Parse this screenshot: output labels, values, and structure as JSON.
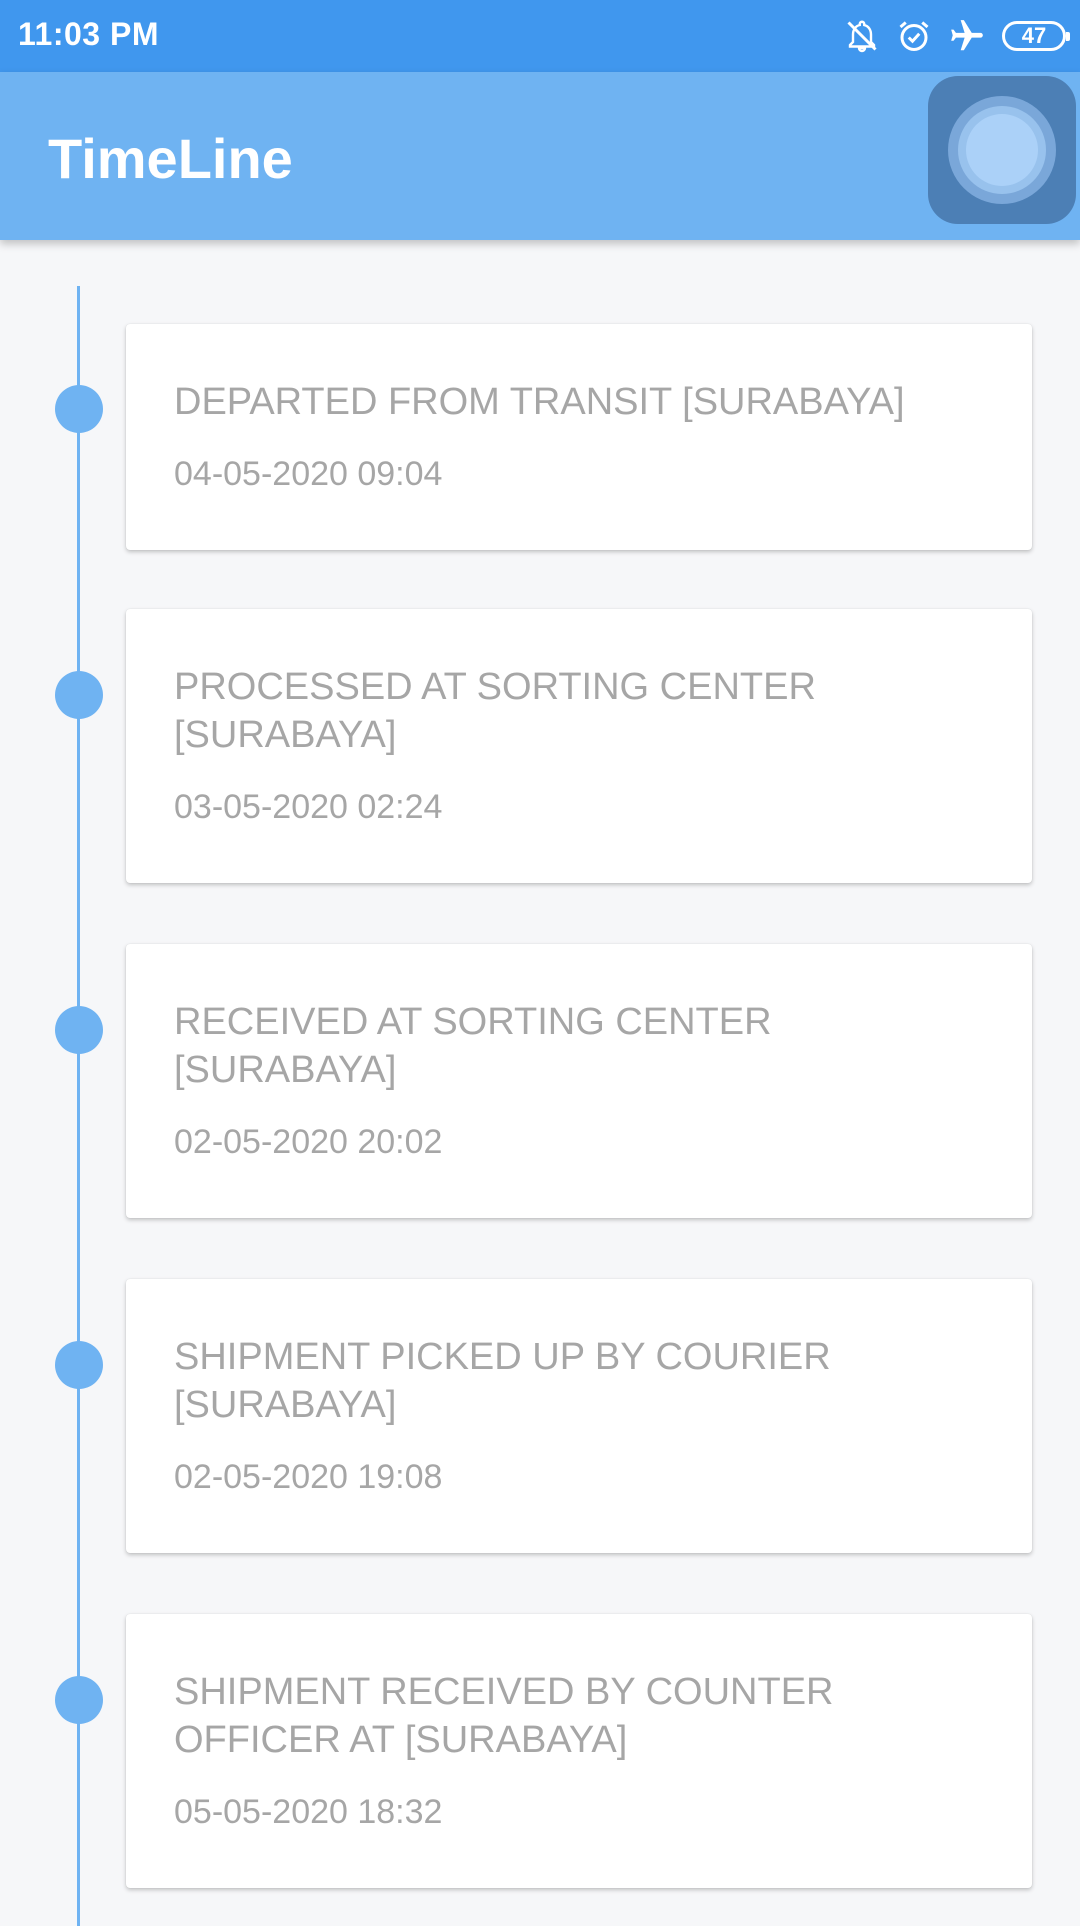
{
  "status_bar": {
    "time": "11:03 PM",
    "battery_level": "47",
    "icons": [
      "notifications-off-icon",
      "alarm-icon",
      "airplane-mode-icon",
      "battery-icon"
    ]
  },
  "app_bar": {
    "title": "TimeLine",
    "assistive_button_icon": "assistive-touch-icon"
  },
  "timeline": {
    "items": [
      {
        "title": "DEPARTED FROM TRANSIT [SURABAYA]",
        "date": "04-05-2020 09:04"
      },
      {
        "title": "PROCESSED AT SORTING CENTER [SURABAYA]",
        "date": "03-05-2020 02:24"
      },
      {
        "title": "RECEIVED AT SORTING CENTER [SURABAYA]",
        "date": "02-05-2020 20:02"
      },
      {
        "title": "SHIPMENT PICKED UP BY COURIER [SURABAYA]",
        "date": "02-05-2020 19:08"
      },
      {
        "title": "SHIPMENT RECEIVED BY COUNTER OFFICER AT [SURABAYA]",
        "date": "05-05-2020 18:32"
      }
    ]
  },
  "colors": {
    "status_bar": "#4097ee",
    "app_bar": "#6fb3f2",
    "timeline_accent": "#6fb3f2",
    "event_text": "#a6a6a6",
    "background": "#f6f7f9"
  }
}
